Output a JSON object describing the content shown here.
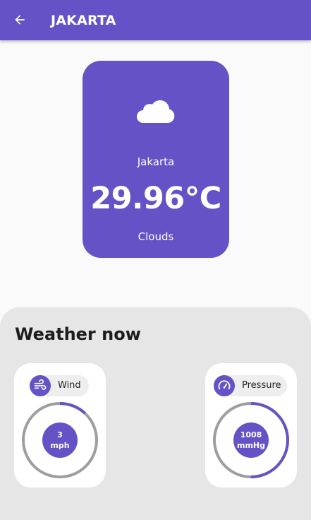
{
  "appbar": {
    "title": "JAKARTA",
    "back_icon": "arrow-left-icon"
  },
  "weather_card": {
    "icon": "cloud-icon",
    "city": "Jakarta",
    "temperature": "29.96°C",
    "condition": "Clouds"
  },
  "weather_now": {
    "title": "Weather now",
    "wind": {
      "label": "Wind",
      "icon": "wind-icon",
      "value": "3",
      "unit": "mph",
      "fill_fraction": 0.12
    },
    "pressure": {
      "label": "Pressure",
      "icon": "speedometer-icon",
      "value": "1008",
      "unit": "mmHg",
      "fill_fraction": 0.5
    }
  },
  "colors": {
    "primary": "#6552c6",
    "gauge_track": "#9e9e9e",
    "panel_bg": "#e6e6e6"
  }
}
